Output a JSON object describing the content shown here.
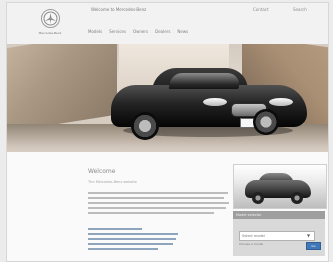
{
  "header": {
    "brand_text": "Mercedes-Benz",
    "title": "Welcome to Mercedes-Benz",
    "links": [
      "Contact",
      "Search"
    ],
    "nav_items": [
      "Models",
      "Services",
      "Owners",
      "Dealers",
      "News"
    ]
  },
  "hero": {
    "plate_text": "S 500"
  },
  "content": {
    "welcome_title": "Welcome",
    "welcome_subtitle": "The Mercedes-Benz website"
  },
  "sidebar": {
    "panel_label": "Model selector",
    "select_value": "Select model",
    "caption": "Choose a model",
    "button_label": "Go"
  }
}
